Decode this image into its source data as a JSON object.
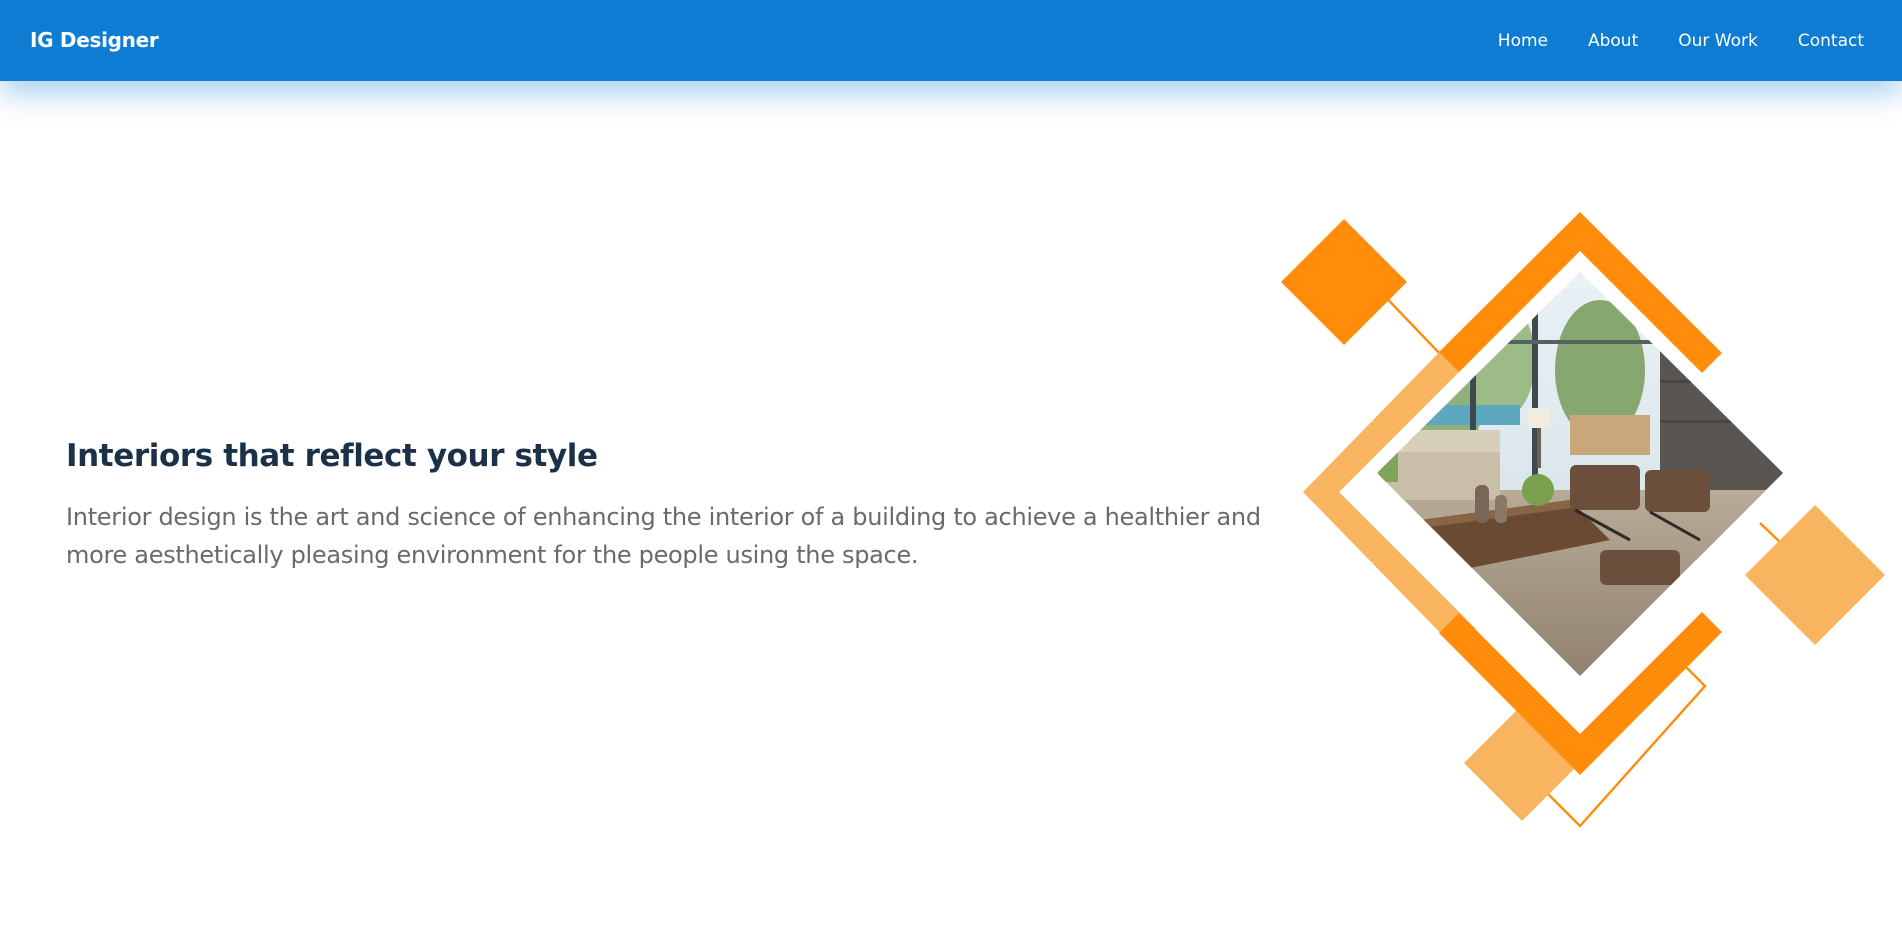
{
  "header": {
    "brand": "IG Designer",
    "nav": [
      {
        "label": "Home"
      },
      {
        "label": "About"
      },
      {
        "label": "Our Work"
      },
      {
        "label": "Contact"
      }
    ]
  },
  "hero": {
    "title": "Interiors that reflect your style",
    "description": "Interior design is the art and science of enhancing the interior of a building to achieve a healthier and more aesthetically pleasing environment for the people using the space."
  },
  "colors": {
    "header_bg": "#0f7cd4",
    "accent_orange": "#ff8c0a",
    "accent_light_orange": "#f9b460",
    "title_text": "#1b3148",
    "body_text": "#6a6a6a"
  }
}
